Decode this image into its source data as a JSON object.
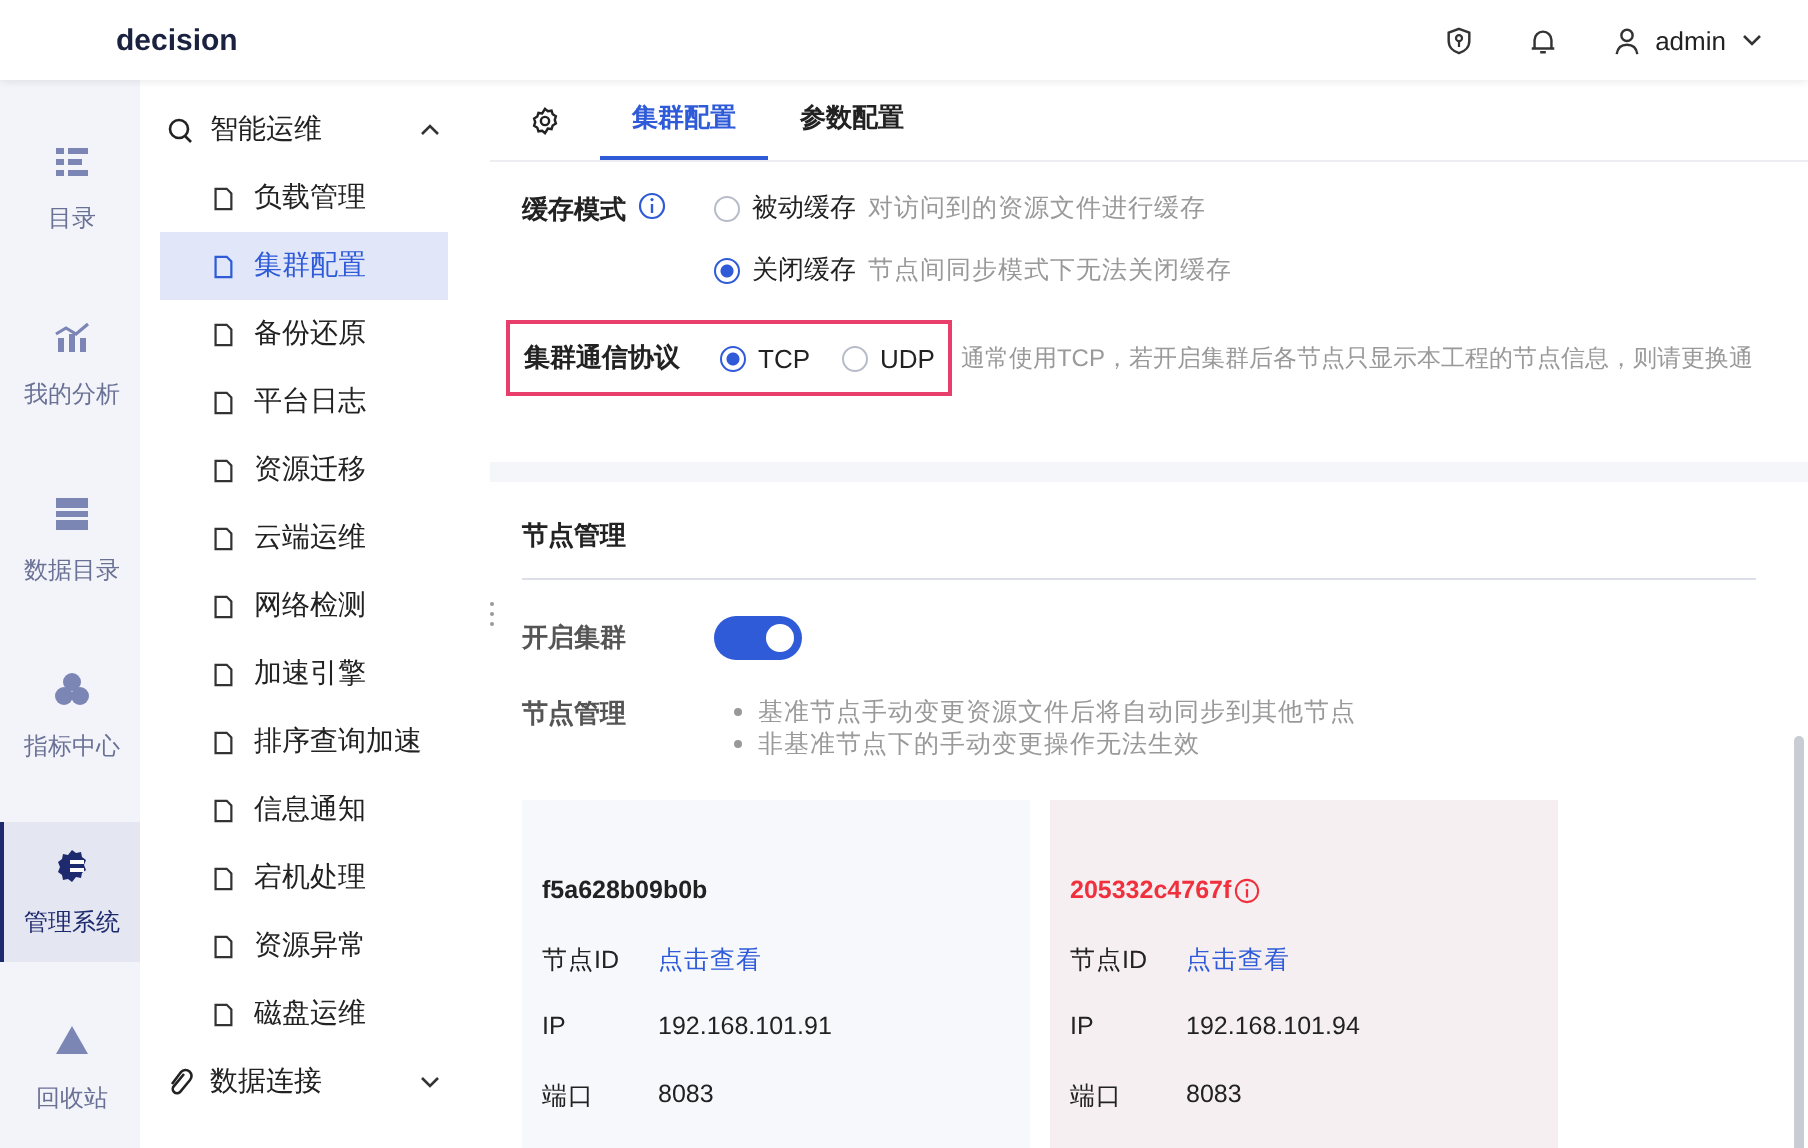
{
  "header": {
    "logo": "decision",
    "user": "admin"
  },
  "rail": [
    {
      "label": "目录",
      "selected": false
    },
    {
      "label": "我的分析",
      "selected": false
    },
    {
      "label": "数据目录",
      "selected": false
    },
    {
      "label": "指标中心",
      "selected": false
    },
    {
      "label": "管理系统",
      "selected": true
    },
    {
      "label": "回收站",
      "selected": false
    }
  ],
  "menu": [
    {
      "label": "智能运维",
      "expanded": true,
      "children": [
        {
          "label": "负载管理",
          "selected": false
        },
        {
          "label": "集群配置",
          "selected": true
        },
        {
          "label": "备份还原",
          "selected": false
        },
        {
          "label": "平台日志",
          "selected": false
        },
        {
          "label": "资源迁移",
          "selected": false
        },
        {
          "label": "云端运维",
          "selected": false
        },
        {
          "label": "网络检测",
          "selected": false
        },
        {
          "label": "加速引擎",
          "selected": false
        },
        {
          "label": "排序查询加速",
          "selected": false
        },
        {
          "label": "信息通知",
          "selected": false
        },
        {
          "label": "宕机处理",
          "selected": false
        },
        {
          "label": "资源异常",
          "selected": false
        },
        {
          "label": "磁盘运维",
          "selected": false
        }
      ]
    },
    {
      "label": "数据连接",
      "expanded": false
    }
  ],
  "tabs": [
    {
      "label": "集群配置",
      "selected": true
    },
    {
      "label": "参数配置",
      "selected": false
    }
  ],
  "cache_mode": {
    "label": "缓存模式",
    "options": [
      {
        "label": "被动缓存",
        "hint": "对访问到的资源文件进行缓存",
        "selected": false
      },
      {
        "label": "关闭缓存",
        "hint": "节点间同步模式下无法关闭缓存",
        "selected": true
      }
    ]
  },
  "protocol": {
    "label": "集群通信协议",
    "highlighted": true,
    "options": [
      {
        "label": "TCP",
        "selected": true
      },
      {
        "label": "UDP",
        "selected": false
      }
    ],
    "hint": "通常使用TCP，若开启集群后各节点只显示本工程的节点信息，则请更换通"
  },
  "node_section": {
    "title": "节点管理",
    "cluster": {
      "label": "开启集群",
      "on": true
    },
    "notes": {
      "label": "节点管理",
      "items": [
        "基准节点手动变更资源文件后将自动同步到其他节点",
        "非基准节点下的手动变更操作无法生效"
      ]
    },
    "nodes": [
      {
        "name": "f5a628b09b0b",
        "abnormal": false,
        "id_label": "节点ID",
        "id_link": "点击查看",
        "ip_label": "IP",
        "ip": "192.168.101.91",
        "port_label": "端口",
        "port": "8083"
      },
      {
        "name": "205332c4767f",
        "abnormal": true,
        "id_label": "节点ID",
        "id_link": "点击查看",
        "ip_label": "IP",
        "ip": "192.168.101.94",
        "port_label": "端口",
        "port": "8083"
      }
    ]
  }
}
